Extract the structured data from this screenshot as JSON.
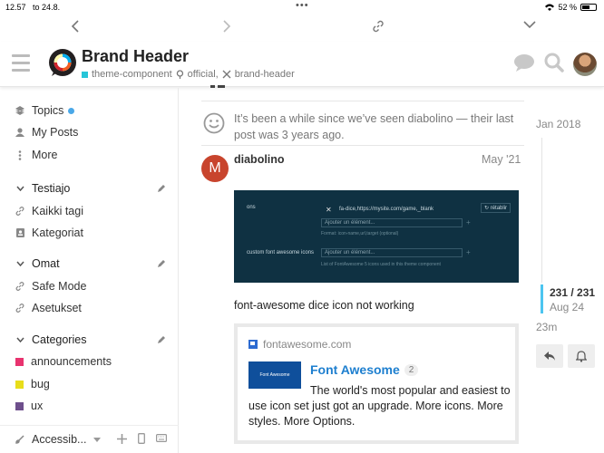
{
  "status_bar": {
    "time": "12.57",
    "date": "to 24.8.",
    "battery": "52 %"
  },
  "header": {
    "title": "Brand Header",
    "tag_category": "theme-component",
    "tag_official": "official,",
    "tag_brand": "brand-header"
  },
  "sidebar": {
    "topics": "Topics",
    "my_posts": "My Posts",
    "more": "More",
    "section1": {
      "title": "Testiajo",
      "items": [
        "Kaikki tagi",
        "Kategoriat"
      ]
    },
    "section2": {
      "title": "Omat",
      "items": [
        "Safe Mode",
        "Asetukset"
      ]
    },
    "categories": {
      "title": "Categories",
      "items": [
        {
          "label": "announcements",
          "color": "#e8336f"
        },
        {
          "label": "bug",
          "color": "#e8dd1a"
        },
        {
          "label": "ux",
          "color": "#6e4f8c"
        }
      ]
    },
    "footer_label": "Accessib..."
  },
  "post": {
    "notice": "It’s been a while since we’ve seen diabolino — their last post was 3 years ago.",
    "avatar_letter": "M",
    "username": "diabolino",
    "date": "May '21",
    "screenshot": {
      "label1": "ons",
      "field1": "fa-dice,https://mysite.com/game,_blank",
      "input1": "Ajouter un élément...",
      "hint1": "Format: icon-name,url,target (optional)",
      "reset": "rétablir",
      "label2": "custom font awesome icons",
      "input2": "Ajouter un élément...",
      "hint2": "List of FontAwesome 5 icons used in this theme component"
    },
    "text": "font-awesome dice icon not working",
    "onebox": {
      "site": "fontawesome.com",
      "thumb_text": "Font Awesome",
      "title": "Font Awesome",
      "badge": "2",
      "description": "The world's most popular and easiest to use icon set just got an upgrade. More icons. More styles. More Options."
    }
  },
  "timeline": {
    "start": "Jan 2018",
    "position": "231 / 231",
    "position_date": "Aug 24",
    "ago": "23m"
  }
}
